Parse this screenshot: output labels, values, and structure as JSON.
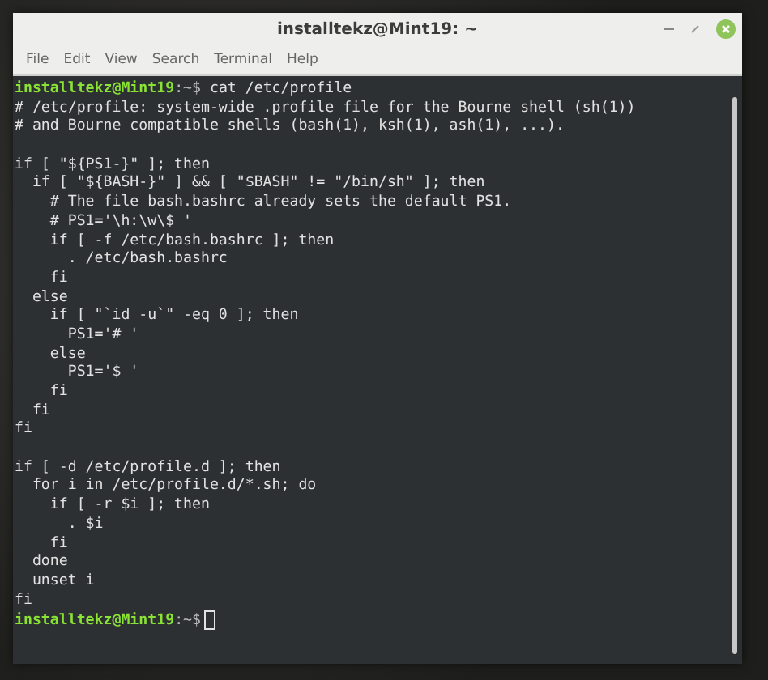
{
  "window": {
    "title": "installtekz@Mint19: ~"
  },
  "menu": [
    "File",
    "Edit",
    "View",
    "Search",
    "Terminal",
    "Help"
  ],
  "terminal": {
    "lines": [
      {
        "kind": "prompt",
        "user": "installtekz@Mint19",
        "suffix": ":~$",
        "command": "cat /etc/profile",
        "cursor": false
      },
      {
        "kind": "output",
        "text": "# /etc/profile: system-wide .profile file for the Bourne shell (sh(1))"
      },
      {
        "kind": "output",
        "text": "# and Bourne compatible shells (bash(1), ksh(1), ash(1), ...)."
      },
      {
        "kind": "blank"
      },
      {
        "kind": "output",
        "text": "if [ \"${PS1-}\" ]; then"
      },
      {
        "kind": "output",
        "text": "  if [ \"${BASH-}\" ] && [ \"$BASH\" != \"/bin/sh\" ]; then"
      },
      {
        "kind": "output",
        "text": "    # The file bash.bashrc already sets the default PS1."
      },
      {
        "kind": "output",
        "text": "    # PS1='\\h:\\w\\$ '"
      },
      {
        "kind": "output",
        "text": "    if [ -f /etc/bash.bashrc ]; then"
      },
      {
        "kind": "output",
        "text": "      . /etc/bash.bashrc"
      },
      {
        "kind": "output",
        "text": "    fi"
      },
      {
        "kind": "output",
        "text": "  else"
      },
      {
        "kind": "output",
        "text": "    if [ \"`id -u`\" -eq 0 ]; then"
      },
      {
        "kind": "output",
        "text": "      PS1='# '"
      },
      {
        "kind": "output",
        "text": "    else"
      },
      {
        "kind": "output",
        "text": "      PS1='$ '"
      },
      {
        "kind": "output",
        "text": "    fi"
      },
      {
        "kind": "output",
        "text": "  fi"
      },
      {
        "kind": "output",
        "text": "fi"
      },
      {
        "kind": "blank"
      },
      {
        "kind": "output",
        "text": "if [ -d /etc/profile.d ]; then"
      },
      {
        "kind": "output",
        "text": "  for i in /etc/profile.d/*.sh; do"
      },
      {
        "kind": "output",
        "text": "    if [ -r $i ]; then"
      },
      {
        "kind": "output",
        "text": "      . $i"
      },
      {
        "kind": "output",
        "text": "    fi"
      },
      {
        "kind": "output",
        "text": "  done"
      },
      {
        "kind": "output",
        "text": "  unset i"
      },
      {
        "kind": "output",
        "text": "fi"
      },
      {
        "kind": "prompt",
        "user": "installtekz@Mint19",
        "suffix": ":~$",
        "cursor": true
      }
    ]
  }
}
